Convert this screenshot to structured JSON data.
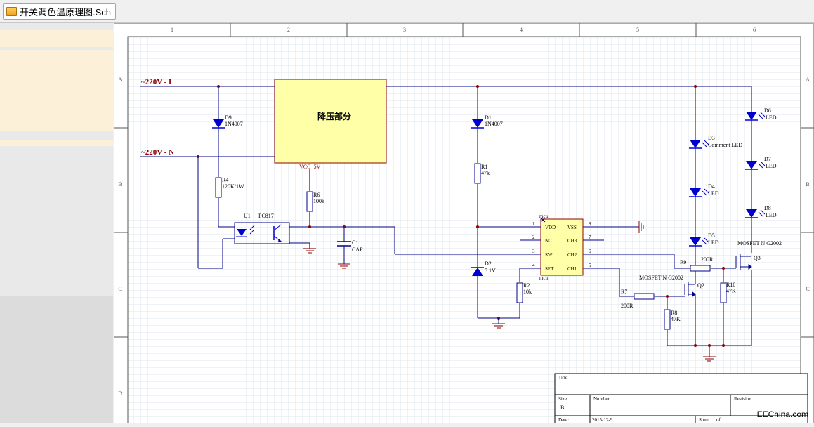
{
  "tab": {
    "title": "开关调色温原理图.Sch"
  },
  "border": {
    "columns": [
      "1",
      "2",
      "3",
      "4",
      "5",
      "6"
    ],
    "rows": [
      "A",
      "B",
      "C",
      "D"
    ]
  },
  "nets": {
    "l": "~220V - L",
    "n": "~220V - N",
    "vcc": "VCC_5V"
  },
  "block": {
    "label": "降压部分"
  },
  "components": {
    "d9": {
      "ref": "D9",
      "val": "1N4007"
    },
    "d1": {
      "ref": "D1",
      "val": "1N4007"
    },
    "d2": {
      "ref": "D2",
      "val": "5.1V"
    },
    "d3": {
      "ref": "D3",
      "val": "Comment LED"
    },
    "d4": {
      "ref": "D4",
      "val": "LED"
    },
    "d5": {
      "ref": "D5",
      "val": "LED"
    },
    "d6": {
      "ref": "D6",
      "val": "LED"
    },
    "d7": {
      "ref": "D7",
      "val": "LED"
    },
    "d8": {
      "ref": "D8",
      "val": "LED"
    },
    "r1": {
      "ref": "R1",
      "val": "47k"
    },
    "r2": {
      "ref": "R2",
      "val": "10k"
    },
    "r4": {
      "ref": "R4",
      "val": "120K/1W"
    },
    "r6": {
      "ref": "R6",
      "val": "100k"
    },
    "r7": {
      "ref": "R7",
      "val": "200R"
    },
    "r8": {
      "ref": "R8",
      "val": "47K"
    },
    "r9": {
      "ref": "R9",
      "val": "200R"
    },
    "r10": {
      "ref": "R10",
      "val": "47K"
    },
    "c1": {
      "ref": "C1",
      "val": "CAP"
    },
    "u1": {
      "ref": "U1",
      "val": "PC817"
    },
    "q2": {
      "ref": "Q2",
      "val": "MOSFET N G2002"
    },
    "q3": {
      "ref": "Q3",
      "val": "MOSFET N G2002"
    },
    "mcu": {
      "top": "mcu",
      "bottom": "mcu",
      "pins_left": [
        "1",
        "2",
        "3",
        "4"
      ],
      "pins_right": [
        "8",
        "7",
        "6",
        "5"
      ],
      "names_left": [
        "VDD",
        "NC",
        "SW",
        "SET"
      ],
      "names_right": [
        "VSS",
        "CH3",
        "CH2",
        "CH1"
      ]
    }
  },
  "titleblock": {
    "title": "Title",
    "size": "Size",
    "size_val": "B",
    "number": "Number",
    "revision": "Revision",
    "date": "Date:",
    "date_val": "2015-12-9",
    "sheet": "Sheet",
    "of": "of"
  },
  "watermark": "EEChina.com",
  "colors": {
    "wire": "#00008b",
    "part": "#0000cd",
    "block_fill": "#ffffa8",
    "block_border": "#8b0000",
    "border_text": "#8b0000",
    "panel_accent": "#fdf0d8"
  }
}
